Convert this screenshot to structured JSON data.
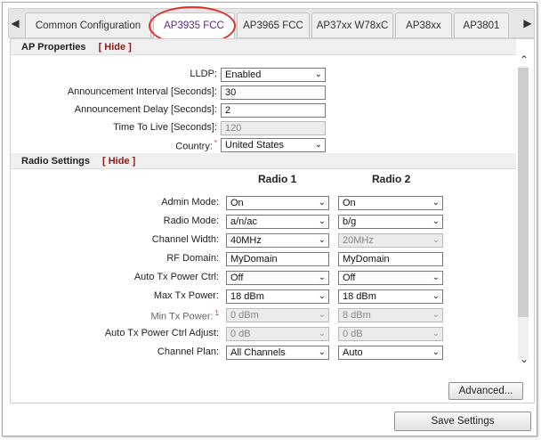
{
  "tabs": [
    {
      "label": "Common Configuration",
      "active": false
    },
    {
      "label": "AP3935 FCC",
      "active": true
    },
    {
      "label": "AP3965 FCC",
      "active": false
    },
    {
      "label": "AP37xx W78xC",
      "active": false
    },
    {
      "label": "AP38xx",
      "active": false
    },
    {
      "label": "AP3801",
      "active": false
    }
  ],
  "tab_nav": {
    "left": "◀",
    "right": "▶"
  },
  "ap_properties": {
    "title": "AP Properties",
    "hide": "[ Hide ]",
    "lldp": {
      "label": "LLDP:",
      "value": "Enabled"
    },
    "announcement_interval": {
      "label": "Announcement Interval [Seconds]:",
      "value": "30"
    },
    "announcement_delay": {
      "label": "Announcement Delay [Seconds]:",
      "value": "2"
    },
    "time_to_live": {
      "label": "Time To Live [Seconds]:",
      "value": "120"
    },
    "country": {
      "label": "Country:",
      "required": "*",
      "value": "United States"
    }
  },
  "radio_settings": {
    "title": "Radio Settings",
    "hide": "[ Hide ]",
    "radio1_header": "Radio 1",
    "radio2_header": "Radio 2",
    "rows": [
      {
        "label": "Admin Mode:",
        "r1": "On",
        "r2": "On"
      },
      {
        "label": "Radio Mode:",
        "r1": "a/n/ac",
        "r2": "b/g"
      },
      {
        "label": "Channel Width:",
        "r1": "40MHz",
        "r2": "20MHz"
      },
      {
        "label": "RF Domain:",
        "r1": "MyDomain",
        "r2": "MyDomain"
      },
      {
        "label": "Auto Tx Power Ctrl:",
        "r1": "Off",
        "r2": "Off"
      },
      {
        "label": "Max Tx Power:",
        "r1": "18 dBm",
        "r2": "18 dBm"
      },
      {
        "label": "Min Tx Power:",
        "required": "1",
        "r1": "0 dBm",
        "r2": "8 dBm"
      },
      {
        "label": "Auto Tx Power Ctrl Adjust:",
        "r1": "0 dB",
        "r2": "0 dB"
      },
      {
        "label": "Channel Plan:",
        "r1": "All Channels",
        "r2": "Auto"
      }
    ]
  },
  "buttons": {
    "advanced": "Advanced...",
    "save": "Save Settings"
  },
  "colors": {
    "active_tab_text": "#5a2a80",
    "hide_link": "#8b1a1a",
    "highlight_ring": "#d9342b"
  }
}
